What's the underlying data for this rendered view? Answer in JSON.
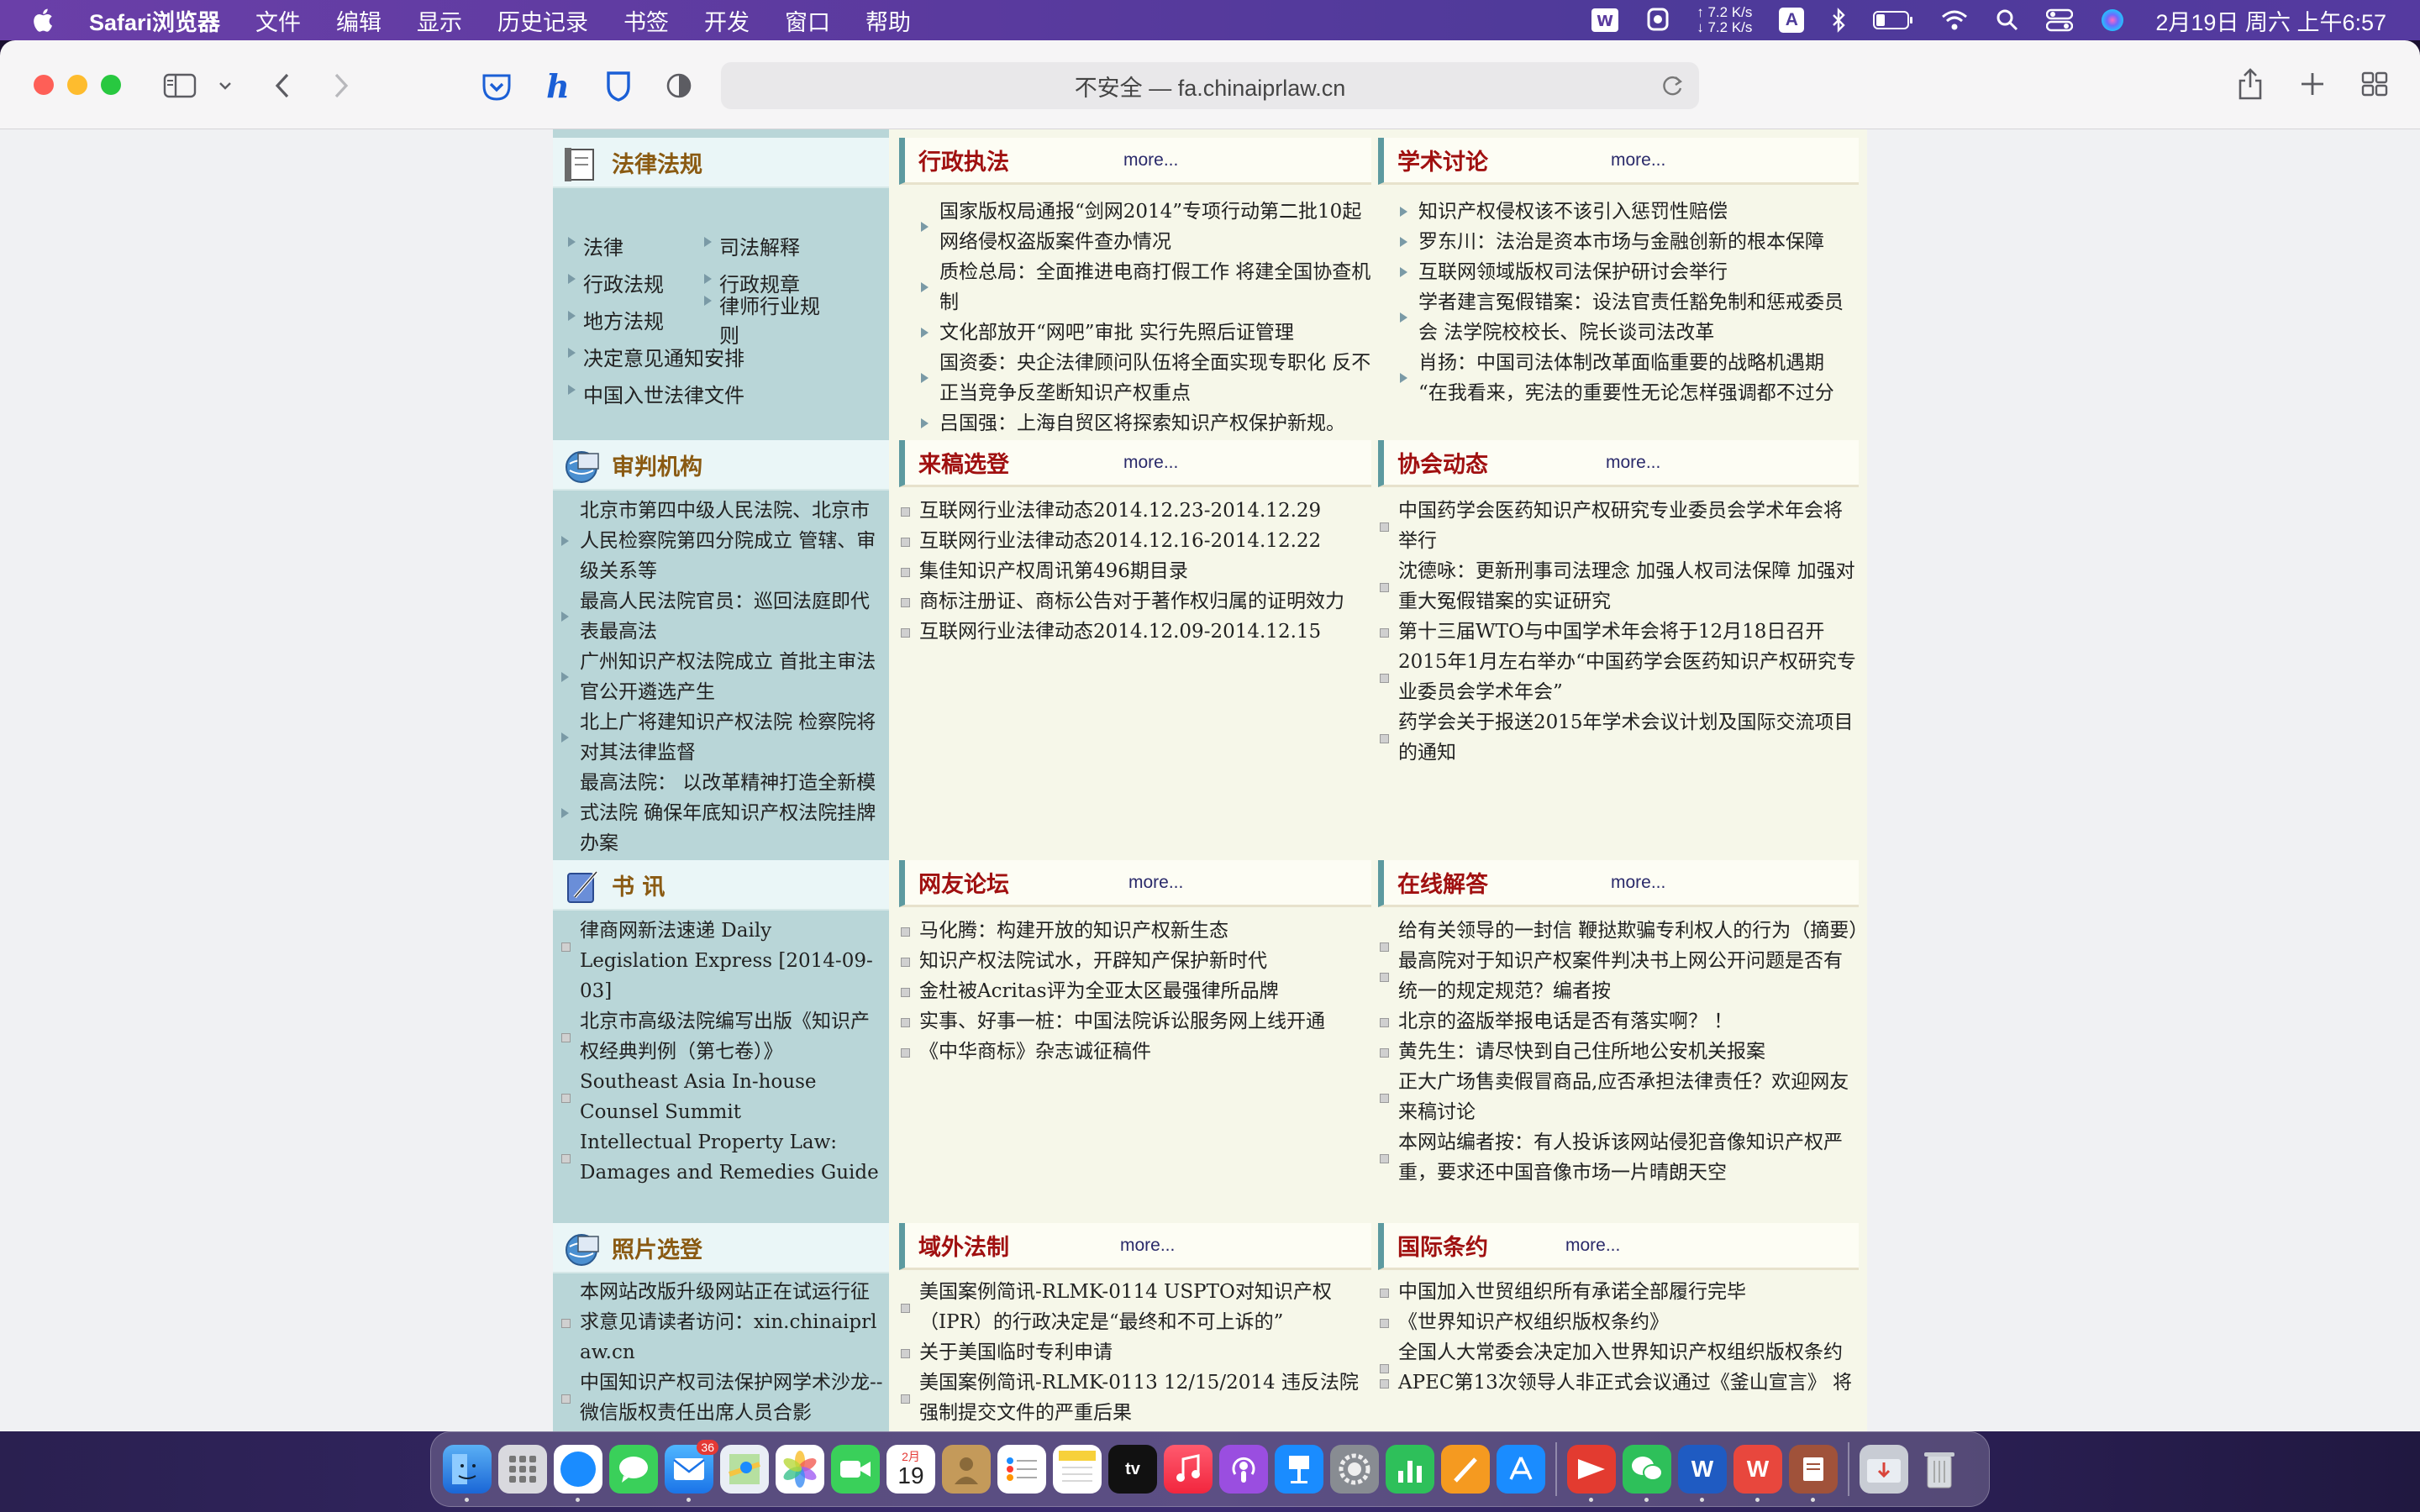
{
  "menubar": {
    "app_name": "Safari浏览器",
    "items": [
      "文件",
      "编辑",
      "显示",
      "历史记录",
      "书签",
      "开发",
      "窗口",
      "帮助"
    ],
    "net_up": "↑ 7.2 K/s",
    "net_down": "↓ 7.2 K/s",
    "input_method": "A",
    "clock": "2月19日 周六 上午6:57"
  },
  "toolbar": {
    "address": "不安全 — fa.chinaiprlaw.cn"
  },
  "page": {
    "law": {
      "title": "法律法规",
      "items": [
        [
          "法律",
          "司法解释"
        ],
        [
          "行政法规",
          "行政规章"
        ],
        [
          "地方法规",
          "律师行业规则"
        ],
        [
          "决定意见通知安排"
        ],
        [
          "中国入世法律文件"
        ]
      ]
    },
    "admin": {
      "title": "行政执法",
      "more": "more...",
      "items": [
        "国家版权局通报“剑网2014”专项行动第二批10起网络侵权盗版案件查办情况",
        "质检总局：全面推进电商打假工作 将建全国协查机制",
        "文化部放开“网吧”审批 实行先照后证管理",
        "国资委：央企法律顾问队伍将全面实现专职化 反不正当竞争反垄断知识产权重点",
        "吕国强：上海自贸区将探索知识产权保护新规。"
      ]
    },
    "academic": {
      "title": "学术讨论",
      "more": "more...",
      "items": [
        "知识产权侵权该不该引入惩罚性赔偿",
        "罗东川：法治是资本市场与金融创新的根本保障",
        "互联网领域版权司法保护研讨会举行",
        "学者建言冤假错案：设法官责任豁免制和惩戒委员会 法学院校校长、院长谈司法改革",
        "肖扬：中国司法体制改革面临重要的战略机遇期 “在我看来，宪法的重要性无论怎样强调都不过分"
      ]
    },
    "court": {
      "title": "审判机构",
      "items": [
        "北京市第四中级人民法院、北京市人民检察院第四分院成立 管辖、审级关系等",
        "最高人民法院官员：巡回法庭即代表最高法",
        "广州知识产权法院成立 首批主审法官公开遴选产生",
        "北上广将建知识产权法院 检察院将对其法律监督",
        "最高法院： 以改革精神打造全新模式法院 确保年底知识产权法院挂牌办案"
      ]
    },
    "submit": {
      "title": "来稿选登",
      "more": "more...",
      "items": [
        "互联网行业法律动态2014.12.23-2014.12.29",
        "互联网行业法律动态2014.12.16-2014.12.22",
        "集佳知识产权周讯第496期目录",
        "商标注册证、商标公告对于著作权归属的证明效力",
        "互联网行业法律动态2014.12.09-2014.12.15"
      ]
    },
    "assoc": {
      "title": "协会动态",
      "more": "more...",
      "items": [
        "中国药学会医药知识产权研究专业委员会学术年会将举行",
        "沈德咏：更新刑事司法理念 加强人权司法保障 加强对重大冤假错案的实证研究",
        "第十三届WTO与中国学术年会将于12月18日召开",
        "2015年1月左右举办“中国药学会医药知识产权研究专业委员会学术年会”",
        "药学会关于报送2015年学术会议计划及国际交流项目的通知"
      ]
    },
    "books": {
      "title": "书 讯",
      "items": [
        "律商网新法速递 Daily Legislation Express [2014-09-03]",
        "北京市高级法院编写出版《知识产权经典判例（第七卷）》",
        "Southeast Asia In-house Counsel Summit",
        "Intellectual Property Law: Damages and Remedies Guide"
      ]
    },
    "forum": {
      "title": "网友论坛",
      "more": "more...",
      "items": [
        "马化腾：构建开放的知识产权新生态",
        "知识产权法院试水，开辟知产保护新时代",
        "金杜被Acritas评为全亚太区最强律所品牌",
        "实事、好事一桩：中国法院诉讼服务网上线开通",
        "《中华商标》杂志诚征稿件"
      ]
    },
    "answer": {
      "title": "在线解答",
      "more": "more...",
      "items": [
        "给有关领导的一封信 鞭挞欺骗专利权人的行为（摘要）",
        "最高院对于知识产权案件判决书上网公开问题是否有统一的规定规范？编者按",
        "北京的盗版举报电话是否有落实啊？ ！",
        "黄先生：请尽快到自己住所地公安机关报案",
        "正大广场售卖假冒商品,应否承担法律责任？欢迎网友来稿讨论",
        "本网站编者按：有人投诉该网站侵犯音像知识产权严重，要求还中国音像市场一片晴朗天空"
      ]
    },
    "photos": {
      "title": "照片选登",
      "items": [
        "本网站改版升级网站正在试运行征求意见请读者访问：xin.chinaiprlaw.cn",
        "中国知识产权司法保护网学术沙龙--微信版权责任出席人员合影"
      ]
    },
    "foreign": {
      "title": "域外法制",
      "more": "more...",
      "items": [
        "美国案例简讯-RLMK-0114 USPTO对知识产权（IPR）的行政决定是“最终和不可上诉的”",
        "关于美国临时专利申请",
        "美国案例简讯-RLMK-0113 12/15/2014 违反法院强制提交文件的严重后果"
      ]
    },
    "treaty": {
      "title": "国际条约",
      "more": "more...",
      "items": [
        "中国加入世贸组织所有承诺全部履行完毕",
        "《世界知识产权组织版权条约》",
        "全国人大常委会决定加入世界知识产权组织版权条约",
        "APEC第13次领导人非正式会议通过《釜山宣言》 将"
      ]
    }
  },
  "dock": {
    "mail_badge": "36",
    "calendar_month": "2月",
    "calendar_day": "19"
  }
}
